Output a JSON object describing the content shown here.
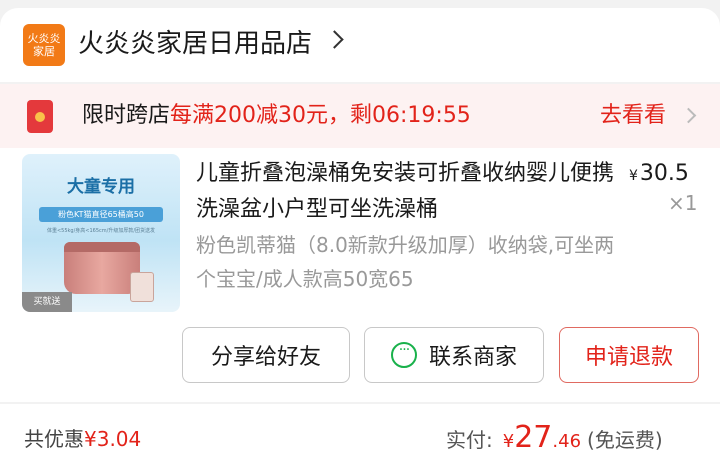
{
  "store": {
    "logo_line1": "火炎炎",
    "logo_line2": "家居",
    "name": "火炎炎家居日用品店"
  },
  "promo": {
    "label": "限时跨店",
    "offer": "每满200减30元，剩06:19:55",
    "action": "去看看"
  },
  "product": {
    "title": "儿童折叠泡澡桶免安装可折叠收纳婴儿便携洗澡盆小户型可坐洗澡桶",
    "price_symbol": "¥",
    "price": "30.5",
    "quantity": "×1",
    "spec": "粉色凯蒂猫（8.0新款升级加厚）收纳袋,可坐两个宝宝/成人款高50宽65",
    "thumbnail": {
      "title": "大童专用",
      "subtitle": "粉色KT猫直径65桶高50",
      "note": "体重<55kg/身高<165cm/升级加厚款/团货送发",
      "gift_tag": "买就送"
    }
  },
  "actions": {
    "share": "分享给好友",
    "contact": "联系商家",
    "refund": "申请退款"
  },
  "summary": {
    "discount_label": "共优惠",
    "discount_value": "¥3.04",
    "paid_label": "实付:",
    "paid_symbol": "¥",
    "paid_integer": "27",
    "paid_decimal": ".46",
    "shipping_note": "(免运费)"
  },
  "colors": {
    "accent_red": "#e2231a",
    "logo_orange": "#f27a16",
    "wechat_green": "#19b14b"
  }
}
